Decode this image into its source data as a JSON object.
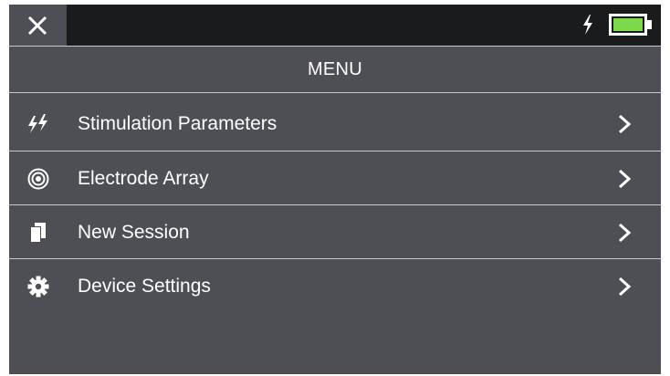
{
  "header": {
    "close_icon": "close-icon",
    "charging_icon": "lightning-bolt-icon",
    "battery_icon": "battery-icon",
    "battery_level": 0.85
  },
  "menu": {
    "title": "MENU",
    "items": [
      {
        "label": "Stimulation Parameters",
        "icon": "double-lightning-icon"
      },
      {
        "label": "Electrode Array",
        "icon": "concentric-circles-icon"
      },
      {
        "label": "New Session",
        "icon": "document-copy-icon"
      },
      {
        "label": "Device Settings",
        "icon": "gear-icon"
      }
    ]
  },
  "colors": {
    "background": "#4d4f55",
    "status_strip": "#1a1b1d",
    "divider": "#c9cbcf",
    "battery_fill": "#7bd94a",
    "text": "#ffffff"
  }
}
